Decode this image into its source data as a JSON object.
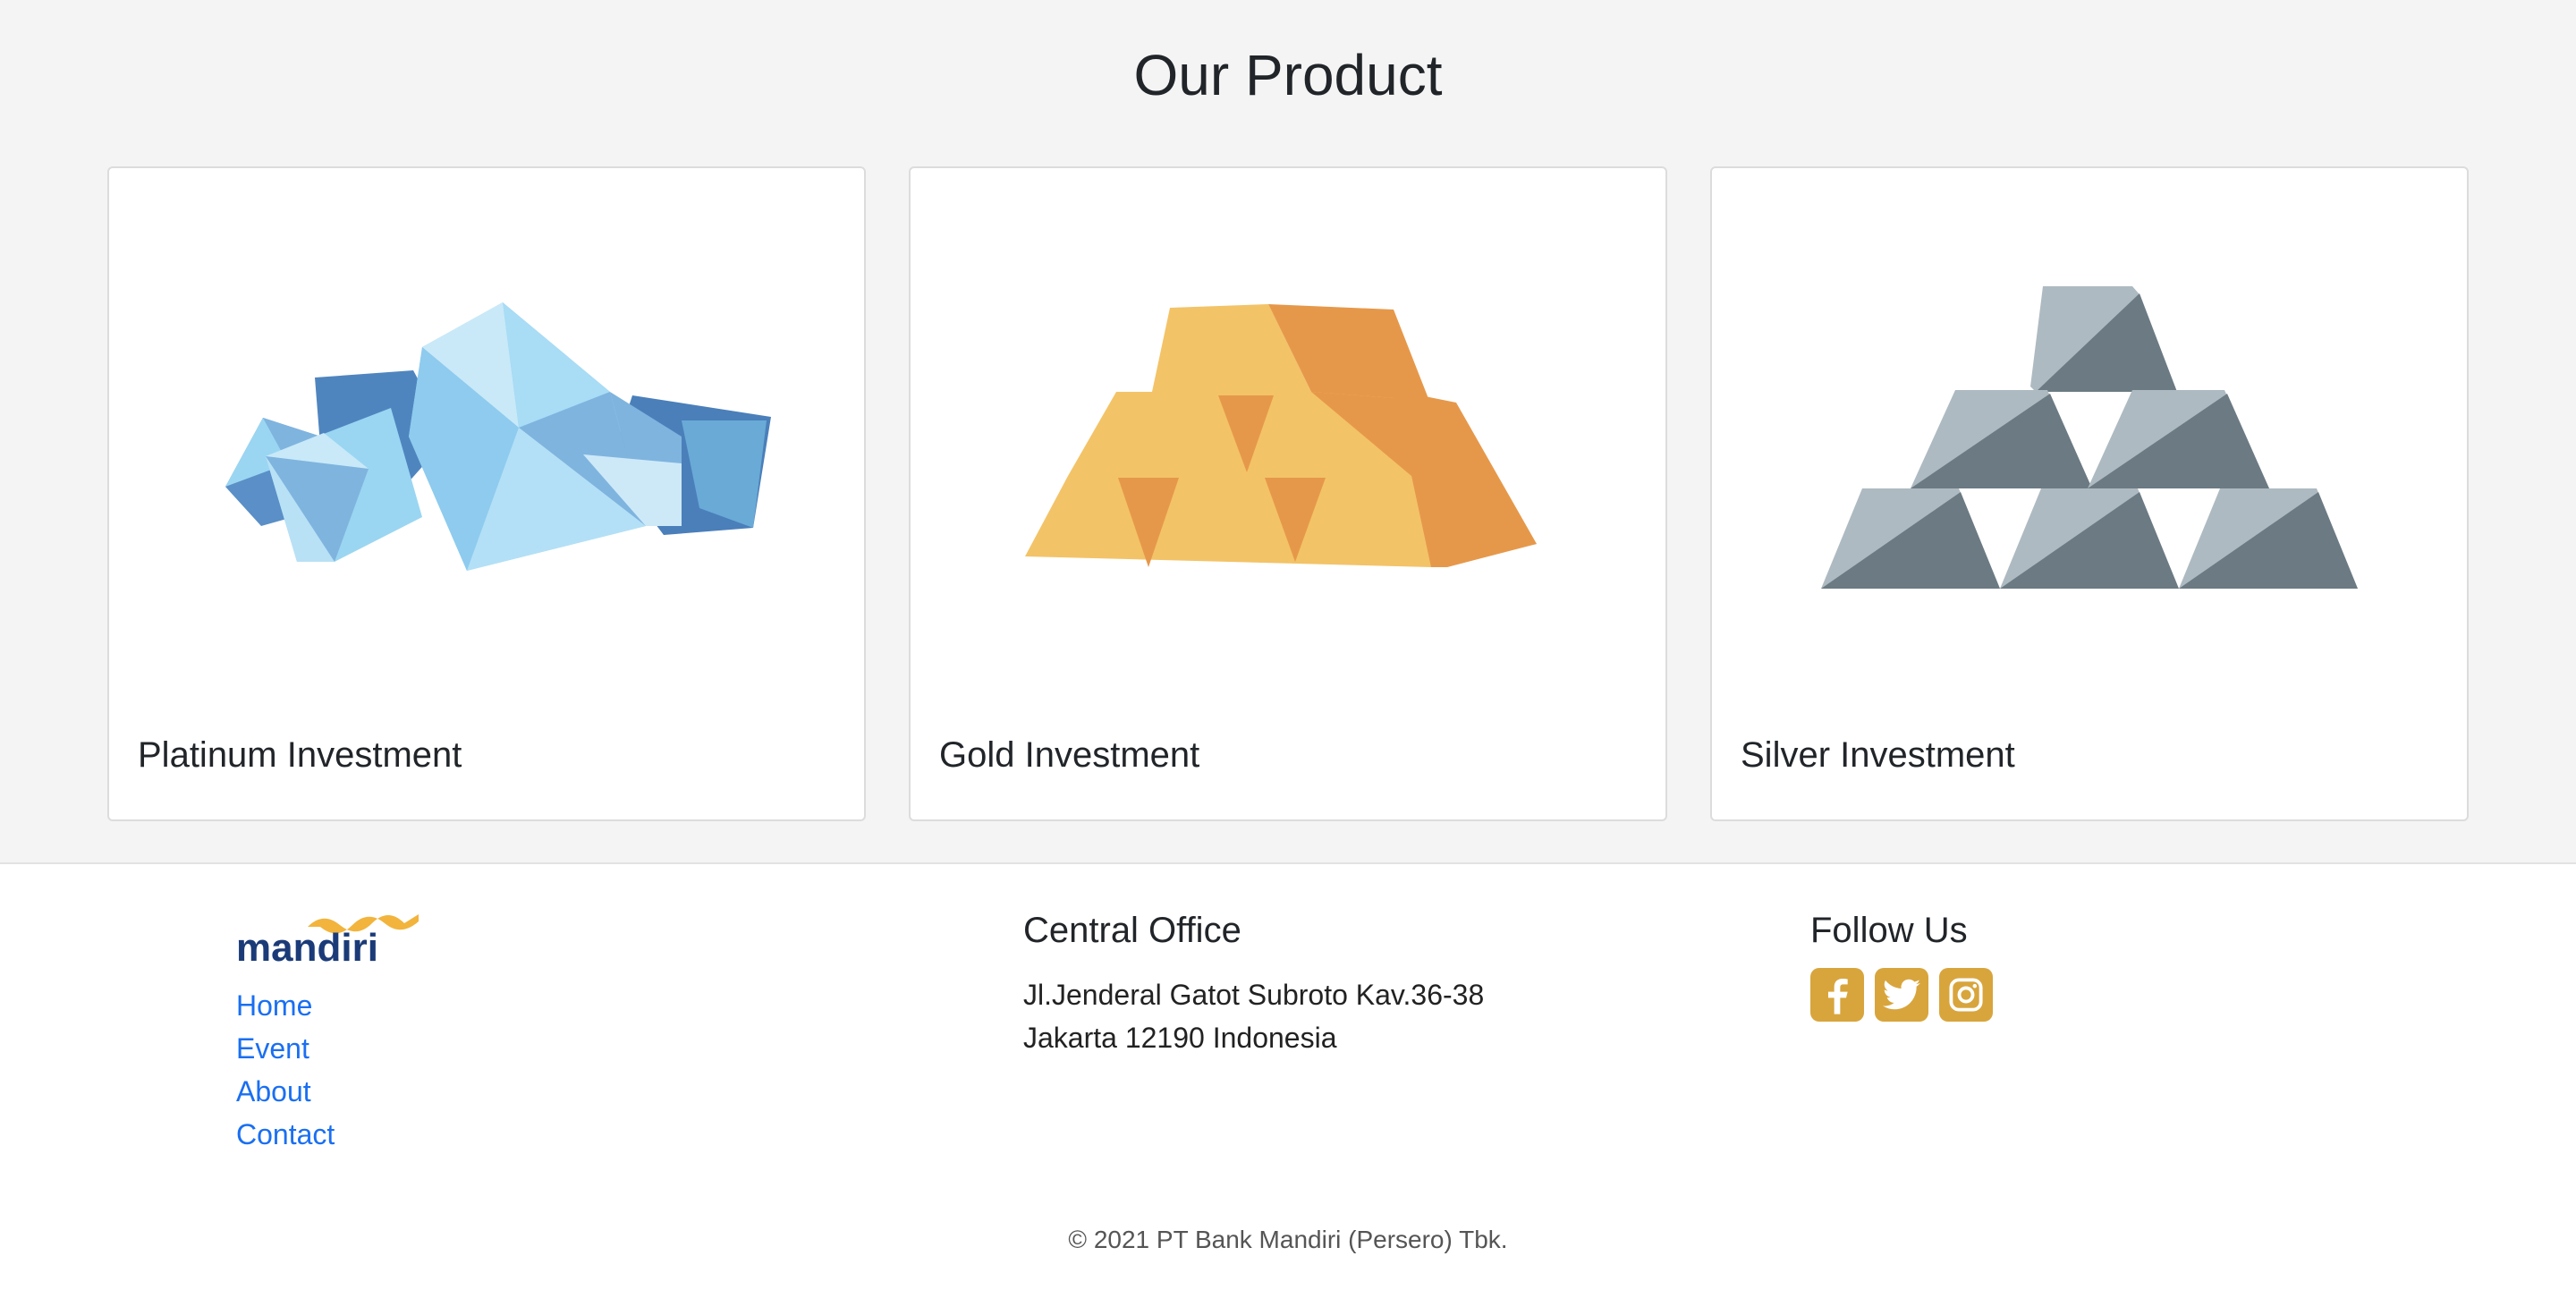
{
  "products": {
    "title": "Our Product",
    "cards": [
      {
        "title": "Platinum Investment",
        "image": "crystal-cluster-illustration"
      },
      {
        "title": "Gold Investment",
        "image": "gold-bars-illustration"
      },
      {
        "title": "Silver Investment",
        "image": "silver-bars-illustration"
      }
    ]
  },
  "footer": {
    "logo_text": "mandiri",
    "nav": [
      "Home",
      "Event",
      "About",
      "Contact"
    ],
    "office": {
      "heading": "Central Office",
      "line1": "Jl.Jenderal Gatot Subroto Kav.36-38",
      "line2": "Jakarta 12190 Indonesia"
    },
    "follow": {
      "heading": "Follow Us",
      "icons": [
        "facebook-icon",
        "twitter-icon",
        "instagram-icon"
      ]
    },
    "copyright": "© 2021 PT Bank Mandiri (Persero) Tbk."
  },
  "colors": {
    "link": "#1a6ff2",
    "social_bg": "#d8a53d",
    "gold_light": "#f3c367",
    "gold_dark": "#e6984a",
    "silver_light": "#aebac1",
    "silver_dark": "#6b7a83",
    "crystal_light": "#9ad6f2",
    "crystal_dark": "#5a8fc7"
  }
}
